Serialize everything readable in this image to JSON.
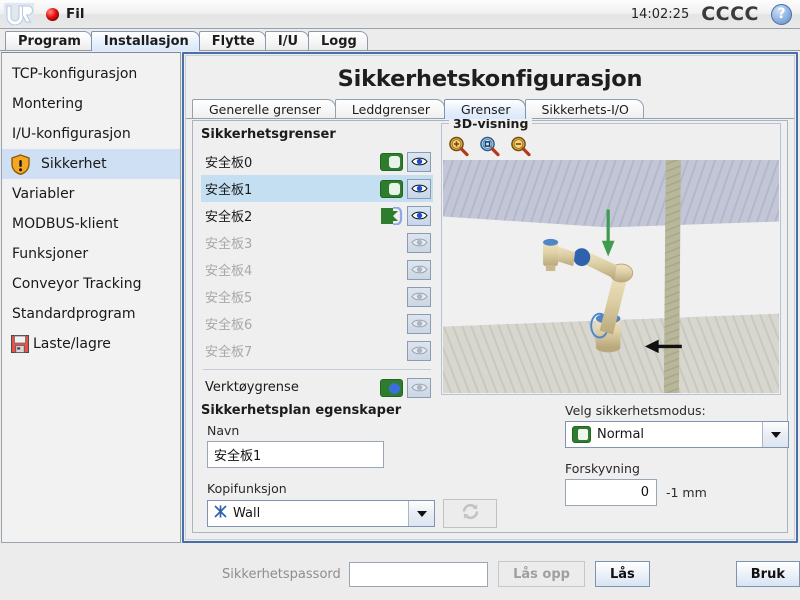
{
  "titlebar": {
    "logo_icon": "ur-logo-icon",
    "file_menu_label": "Fil",
    "file_menu_icon": "red-ball-icon",
    "clock": "14:02:25",
    "robot_name": "CCCC",
    "help_icon": "question-mark-icon",
    "help_label": "?"
  },
  "top_tabs": [
    {
      "label": "Program",
      "active": false
    },
    {
      "label": "Installasjon",
      "active": true
    },
    {
      "label": "Flytte",
      "active": false
    },
    {
      "label": "I/U",
      "active": false
    },
    {
      "label": "Logg",
      "active": false
    }
  ],
  "sidebar": {
    "items": [
      {
        "label": "TCP-konfigurasjon",
        "icon": null,
        "selected": false
      },
      {
        "label": "Montering",
        "icon": null,
        "selected": false
      },
      {
        "label": "I/U-konfigurasjon",
        "icon": null,
        "selected": false
      },
      {
        "label": "Sikkerhet",
        "icon": "warning-shield-icon",
        "selected": true
      },
      {
        "label": "Variabler",
        "icon": null,
        "selected": false
      },
      {
        "label": "MODBUS-klient",
        "icon": null,
        "selected": false
      },
      {
        "label": "Funksjoner",
        "icon": null,
        "selected": false
      },
      {
        "label": "Conveyor Tracking",
        "icon": null,
        "selected": false
      },
      {
        "label": "Standardprogram",
        "icon": null,
        "selected": false
      },
      {
        "label": "Laste/lagre",
        "icon": "floppy-disk-icon",
        "selected": false
      }
    ]
  },
  "main": {
    "title": "Sikkerhetskonfigurasjon",
    "sub_tabs": [
      {
        "label": "Generelle grenser",
        "active": false
      },
      {
        "label": "Leddgrenser",
        "active": false
      },
      {
        "label": "Grenser",
        "active": true
      },
      {
        "label": "Sikkerhets-I/O",
        "active": false
      }
    ]
  },
  "limits": {
    "heading": "Sikkerhetsgrenser",
    "rows": [
      {
        "name": "安全板0",
        "enabled": true,
        "mode": "toggle",
        "eye": "visible",
        "selected": false,
        "dim": false
      },
      {
        "name": "安全板1",
        "enabled": true,
        "mode": "toggle",
        "eye": "visible",
        "selected": true,
        "dim": false
      },
      {
        "name": "安全板2",
        "enabled": true,
        "mode": "trigger",
        "eye": "visible",
        "selected": false,
        "dim": false
      },
      {
        "name": "安全板3",
        "enabled": false,
        "mode": "none",
        "eye": "hidden",
        "selected": false,
        "dim": true
      },
      {
        "name": "安全板4",
        "enabled": false,
        "mode": "none",
        "eye": "hidden",
        "selected": false,
        "dim": true
      },
      {
        "name": "安全板5",
        "enabled": false,
        "mode": "none",
        "eye": "hidden",
        "selected": false,
        "dim": true
      },
      {
        "name": "安全板6",
        "enabled": false,
        "mode": "none",
        "eye": "hidden",
        "selected": false,
        "dim": true
      },
      {
        "name": "安全板7",
        "enabled": false,
        "mode": "none",
        "eye": "hidden",
        "selected": false,
        "dim": true
      }
    ],
    "tool_row": {
      "name": "Verktøygrense",
      "enabled": true,
      "mode": "toggle-blue",
      "eye": "hidden"
    }
  },
  "view3d": {
    "legend": "3D-visning",
    "tools": [
      {
        "icon": "zoom-in-icon"
      },
      {
        "icon": "zoom-fit-icon"
      },
      {
        "icon": "zoom-out-icon"
      }
    ]
  },
  "properties": {
    "heading": "Sikkerhetsplan egenskaper",
    "name_label": "Navn",
    "name_value": "安全板1",
    "name_placeholder": "",
    "copy_label": "Kopifunksjon",
    "copy_value": "Wall",
    "copy_icon": "feature-axes-icon",
    "refresh_icon": "refresh-icon",
    "mode_label": "Velg sikkerhetsmodus:",
    "mode_value": "Normal",
    "mode_icon": "green-toggle-icon",
    "offset_label": "Forskyvning",
    "offset_value": "0",
    "offset_unit": "-1 mm"
  },
  "bottom": {
    "password_label": "Sikkerhetspassord",
    "password_value": "",
    "password_placeholder": "",
    "unlock_label": "Lås opp",
    "lock_label": "Lås",
    "apply_label": "Bruk"
  },
  "colors": {
    "accent_blue": "#4a6fa5",
    "selection_blue": "#c5dff2",
    "sidebar_selection": "#cfe0f5",
    "toggle_green": "#2e7d2e",
    "warning_orange": "#f5a623",
    "panel_bg": "#efefef"
  }
}
